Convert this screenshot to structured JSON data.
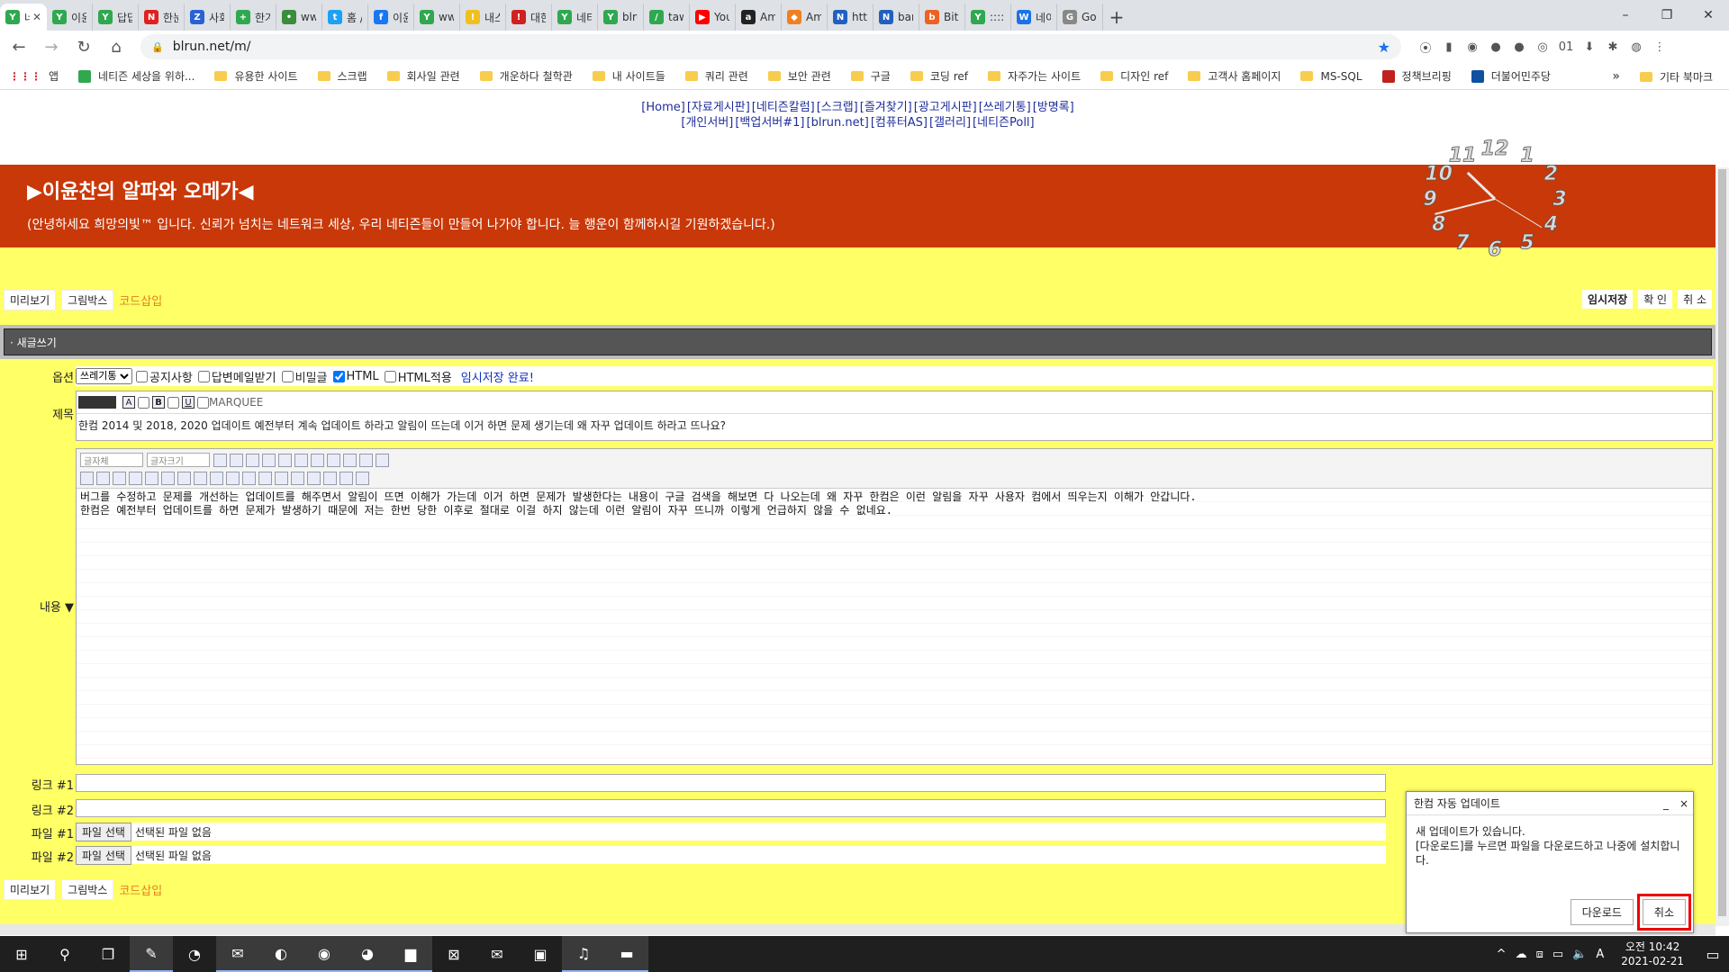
{
  "browser": {
    "tabs": [
      {
        "label": "네",
        "color": "#2fa84f",
        "glyph": "Y",
        "active": true
      },
      {
        "label": "이윤",
        "color": "#2fa84f",
        "glyph": "Y"
      },
      {
        "label": "답답",
        "color": "#2fa84f",
        "glyph": "Y"
      },
      {
        "label": "한눈",
        "color": "#e02020",
        "glyph": "N"
      },
      {
        "label": "사회",
        "color": "#2a62d4",
        "glyph": "Z"
      },
      {
        "label": "한겨",
        "color": "#2fa84f",
        "glyph": "+"
      },
      {
        "label": "www.",
        "color": "#3b8c3b",
        "glyph": "•"
      },
      {
        "label": "홈 /",
        "color": "#1da1f2",
        "glyph": "t"
      },
      {
        "label": "이윤",
        "color": "#1877f2",
        "glyph": "f"
      },
      {
        "label": "www",
        "color": "#2fa84f",
        "glyph": "Y"
      },
      {
        "label": "내스",
        "color": "#f0c020",
        "glyph": "!"
      },
      {
        "label": "대한",
        "color": "#d02020",
        "glyph": "!"
      },
      {
        "label": "네티",
        "color": "#2fa84f",
        "glyph": "Y"
      },
      {
        "label": "blrun",
        "color": "#2fa84f",
        "glyph": "Y"
      },
      {
        "label": "tawk",
        "color": "#2fa84f",
        "glyph": "/"
      },
      {
        "label": "YouT",
        "color": "#ff0000",
        "glyph": "▶"
      },
      {
        "label": "Ama",
        "color": "#222222",
        "glyph": "a"
      },
      {
        "label": "Ama",
        "color": "#f08020",
        "glyph": "◆"
      },
      {
        "label": "https",
        "color": "#2060c0",
        "glyph": "N"
      },
      {
        "label": "bank",
        "color": "#2060c0",
        "glyph": "N"
      },
      {
        "label": "Bitly",
        "color": "#ee6123",
        "glyph": "b"
      },
      {
        "label": "::::: O",
        "color": "#2fa84f",
        "glyph": "Y"
      },
      {
        "label": "네이",
        "color": "#1a73e8",
        "glyph": "W"
      },
      {
        "label": "Goog",
        "color": "#888888",
        "glyph": "G"
      }
    ],
    "new_tab": "+",
    "window_controls": [
      "–",
      "❐",
      "✕"
    ],
    "url": "blrun.net/m/",
    "back": "←",
    "forward": "→",
    "reload": "↻",
    "home": "⌂",
    "star": "★",
    "extensions": [
      "⦿",
      "▮",
      "◉",
      "●",
      "●",
      "◎",
      "01",
      "⬇",
      "✱",
      "◍",
      "⋮"
    ]
  },
  "bookmarks": {
    "apps_label": "앱",
    "items": [
      {
        "label": "네티즌 세상을 위하...",
        "type": "site",
        "color": "#2fa84f"
      },
      {
        "label": "유용한 사이트",
        "type": "folder"
      },
      {
        "label": "스크랩",
        "type": "folder"
      },
      {
        "label": "회사일 관련",
        "type": "folder"
      },
      {
        "label": "개운하다 철학관",
        "type": "folder"
      },
      {
        "label": "내 사이트들",
        "type": "folder"
      },
      {
        "label": "쿼리 관련",
        "type": "folder"
      },
      {
        "label": "보안 관련",
        "type": "folder"
      },
      {
        "label": "구글",
        "type": "folder"
      },
      {
        "label": "코딩 ref",
        "type": "folder"
      },
      {
        "label": "자주가는 사이트",
        "type": "folder"
      },
      {
        "label": "디자인 ref",
        "type": "folder"
      },
      {
        "label": "고객사 홈페이지",
        "type": "folder"
      },
      {
        "label": "MS-SQL",
        "type": "folder"
      },
      {
        "label": "정책브리핑",
        "type": "site",
        "color": "#c02020"
      },
      {
        "label": "더불어민주당",
        "type": "site",
        "color": "#1050a0"
      }
    ],
    "more": "»",
    "other": "기타 북마크"
  },
  "site": {
    "nav_row1": [
      "[Home]",
      "[자료게시판]",
      "[네티즌칼럼]",
      "[스크랩]",
      "[즐겨찾기]",
      "[광고게시판]",
      "[쓰레기통]",
      "[방명록]"
    ],
    "nav_row2": [
      "[개인서버]",
      "[백업서버#1]",
      "[blrun.net]",
      "[컴퓨터AS]",
      "[갤러리]",
      "[네티즌Poll]"
    ],
    "banner_title": "▶이윤찬의 알파와 오메가◀",
    "banner_sub": "(안녕하세요 희망의빛™ 입니다. 신뢰가 넘치는 네트워크 세상, 우리 네티즌들이 만들어 나가야 합니다. 늘 행운이 함께하시길 기원하겠습니다.)",
    "clock_numbers": [
      "12",
      "1",
      "2",
      "3",
      "4",
      "5",
      "6",
      "7",
      "8",
      "9",
      "10",
      "11"
    ],
    "clock": {
      "hour": 10,
      "minute": 42
    }
  },
  "form": {
    "preview": "미리보기",
    "drawbox": "그림박스",
    "code_insert": "코드삽입",
    "temp_save": "임시저장",
    "confirm": "확 인",
    "cancel": "취 소",
    "section_title": "· 새글쓰기",
    "options_label": "옵션",
    "category_value": "쓰레기통",
    "chk_notice": "공지사항",
    "chk_reply_mail": "답변메일받기",
    "chk_secret": "비밀글",
    "chk_html": "HTML",
    "chk_html_apply": "HTML적용",
    "saved_msg": "임시저장 완료!",
    "subject_label": "제목",
    "fmt_a": "A",
    "fmt_b": "B",
    "fmt_u": "U",
    "marquee": "MARQUEE",
    "subject_value": "한컴 2014 및 2018, 2020 업데이트 예전부터 계속 업데이트 하라고 알림이 뜨는데 이거 하면 문제 생기는데 왜 자꾸 업데이트 하라고 뜨나요?",
    "font_select": "글자체",
    "size_select": "글자크기",
    "content_label": "내용 ▼",
    "content_line1": "버그를 수정하고 문제를 개선하는 업데이트를 해주면서 알림이 뜨면 이해가 가는데 이거 하면 문제가 발생한다는 내용이 구글 검색을 해보면 다 나오는데 왜 자꾸 한컴은 이런 알림을 자꾸 사용자 컴에서 띄우는지 이해가 안갑니다.",
    "content_line2": "한컴은 예전부터 업데이트를 하면 문제가 발생하기 때문에 저는 한번 당한 이후로 절대로 이걸 하지 않는데 이런 알림이 자꾸 뜨니까 이렇게 언급하지 않을 수 없네요.",
    "link1_label": "링크 #1",
    "link2_label": "링크 #2",
    "file1_label": "파일 #1",
    "file2_label": "파일 #2",
    "file_button": "파일 선택",
    "no_file": "선택된 파일 없음"
  },
  "popup": {
    "title": "한컴 자동 업데이트",
    "minimize": "_",
    "close": "×",
    "line1": "새 업데이트가 있습니다.",
    "line2": "[다운로드]를 누르면 파일을 다운로드하고 나중에 설치합니다.",
    "download": "다운로드",
    "cancel": "취소"
  },
  "taskbar": {
    "start": "⊞",
    "search": "⚲",
    "taskview": "❐",
    "apps": [
      "✎",
      "◔",
      "✉",
      "◐",
      "◉",
      "◕",
      "▆",
      "⊠",
      "✉",
      "▣",
      "♫",
      "▬"
    ],
    "tray_icons": [
      "^",
      "☁",
      "⧈",
      "▭",
      "🔈",
      "A"
    ],
    "time": "오전 10:42",
    "date": "2021-02-21",
    "notify": "▭"
  }
}
